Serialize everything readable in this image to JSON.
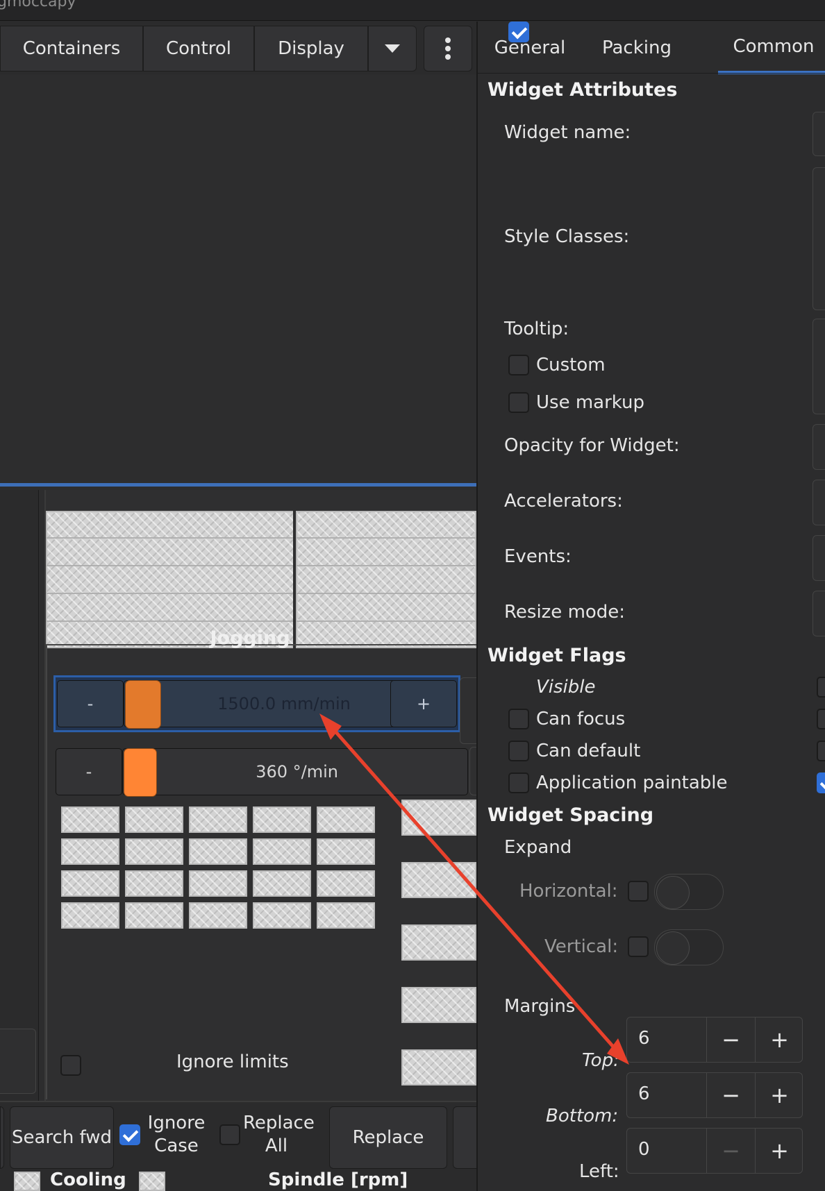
{
  "window": {
    "title": "gmoccapy"
  },
  "palette": {
    "tabs": [
      "Containers",
      "Control",
      "Display"
    ],
    "dropdown_icon": "chevron-down-icon",
    "menu_icon": "vertical-ellipsis-icon"
  },
  "jogging": {
    "title": "Jogging",
    "linear": {
      "minus": "-",
      "plus": "+",
      "value": "1500.0 mm/min"
    },
    "angular": {
      "minus": "-",
      "value": "360 °/min"
    },
    "ignore_limits": "Ignore limits"
  },
  "search": {
    "search_fwd": "Search fwd",
    "ignore_case": "Ignore Case",
    "replace_all": "Replace All",
    "replace": "Replace"
  },
  "status": {
    "cooling": "Cooling",
    "spindle": "Spindle [rpm]"
  },
  "props": {
    "tabs": [
      "General",
      "Packing",
      "Common"
    ],
    "active_tab": "Common",
    "widget_attributes": "Widget Attributes",
    "widget_name": "Widget name:",
    "style_classes": "Style Classes:",
    "tooltip": "Tooltip:",
    "custom": "Custom",
    "use_markup": "Use markup",
    "opacity": "Opacity for Widget:",
    "accelerators": "Accelerators:",
    "events": "Events:",
    "resize_mode": "Resize mode:",
    "widget_flags": "Widget Flags",
    "visible": "Visible",
    "can_focus": "Can focus",
    "can_default": "Can default",
    "app_paintable": "Application paintable",
    "widget_spacing": "Widget Spacing",
    "expand": "Expand",
    "horizontal": "Horizontal:",
    "vertical": "Vertical:",
    "margins": "Margins",
    "top": "Top:",
    "bottom": "Bottom:",
    "left": "Left:",
    "top_value": "6",
    "bottom_value": "6",
    "left_value": "0",
    "minus": "−",
    "plus": "+"
  },
  "colors": {
    "accent": "#3b73c7",
    "arrow": "#e8412c",
    "slider_knob": "#ff8534"
  }
}
